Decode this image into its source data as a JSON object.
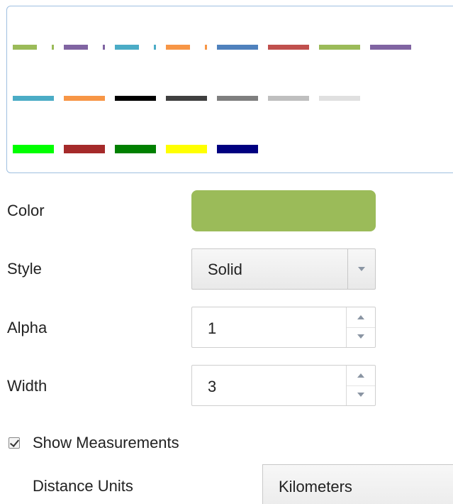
{
  "palette": {
    "rows": [
      [
        {
          "name": "dash-dot-green",
          "color": "#9bbb59",
          "style": "dashdot"
        },
        {
          "name": "dash-dot-purple",
          "color": "#8064a2",
          "style": "dashdot"
        },
        {
          "name": "dash-dot-teal",
          "color": "#4bacc6",
          "style": "dashdot"
        },
        {
          "name": "dash-dot-orange",
          "color": "#f79646",
          "style": "dashdot"
        },
        {
          "name": "solid-blue",
          "color": "#4f81bd",
          "style": "solid"
        },
        {
          "name": "solid-red",
          "color": "#c0504d",
          "style": "solid"
        },
        {
          "name": "solid-green",
          "color": "#9bbb59",
          "style": "solid"
        },
        {
          "name": "solid-purple",
          "color": "#8064a2",
          "style": "solid"
        }
      ],
      [
        {
          "name": "solid-teal",
          "color": "#4bacc6",
          "style": "solid"
        },
        {
          "name": "solid-orange",
          "color": "#f79646",
          "style": "solid"
        },
        {
          "name": "solid-black",
          "color": "#000000",
          "style": "solid"
        },
        {
          "name": "solid-dark-gray",
          "color": "#3f3f3f",
          "style": "solid"
        },
        {
          "name": "solid-gray",
          "color": "#7f7f7f",
          "style": "solid"
        },
        {
          "name": "solid-light-gray",
          "color": "#bfbfbf",
          "style": "solid"
        },
        {
          "name": "solid-lighter-gray",
          "color": "#e0e0e0",
          "style": "solid"
        }
      ],
      [
        {
          "name": "solid-lime",
          "color": "#00ff00",
          "style": "solid"
        },
        {
          "name": "solid-dark-red",
          "color": "#a52a2a",
          "style": "solid"
        },
        {
          "name": "solid-dark-green",
          "color": "#008000",
          "style": "solid"
        },
        {
          "name": "solid-yellow",
          "color": "#ffff00",
          "style": "solid"
        },
        {
          "name": "solid-navy",
          "color": "#000080",
          "style": "solid"
        }
      ]
    ]
  },
  "form": {
    "color_label": "Color",
    "color_value": "#9bbb59",
    "style_label": "Style",
    "style_value": "Solid",
    "alpha_label": "Alpha",
    "alpha_value": "1",
    "width_label": "Width",
    "width_value": "3",
    "show_measurements_label": "Show Measurements",
    "show_measurements_checked": true,
    "distance_units_label": "Distance Units",
    "distance_units_value": "Kilometers"
  },
  "colors": {
    "panel_border": "#9fbfe0",
    "arrow": "#8a95a3"
  }
}
